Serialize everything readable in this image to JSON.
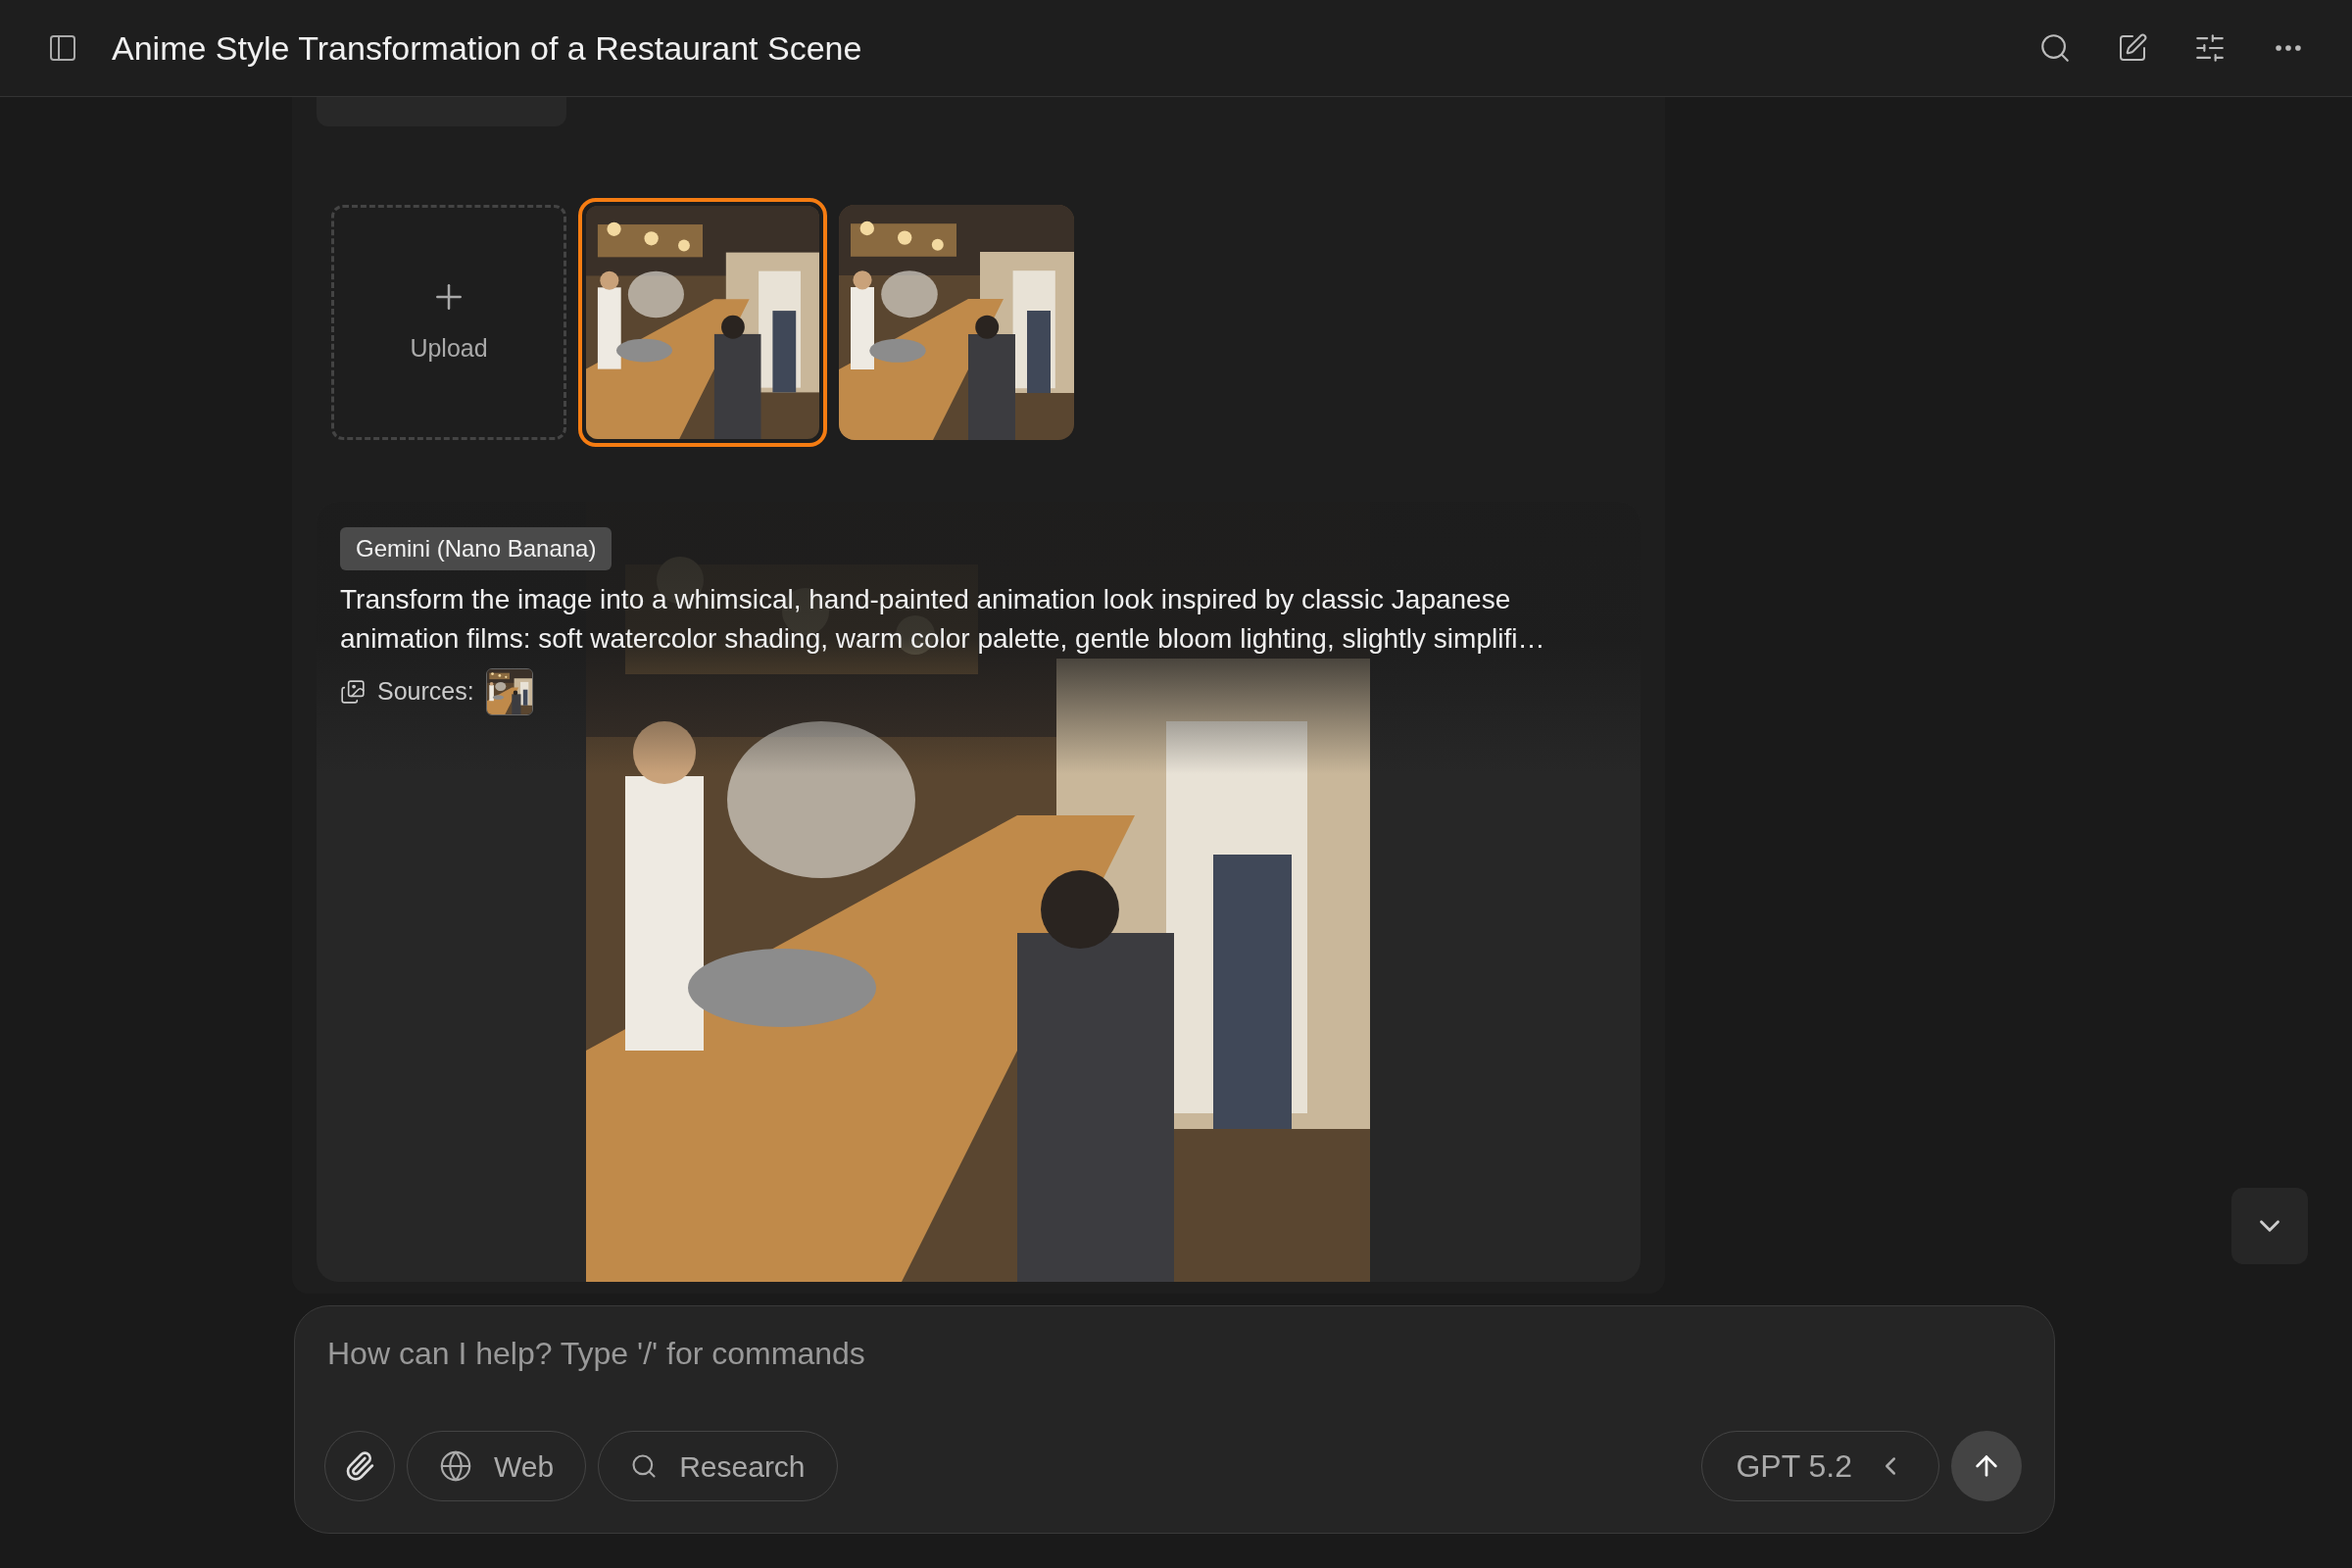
{
  "header": {
    "title": "Anime Style Transformation of a Restaurant Scene"
  },
  "upload": {
    "label": "Upload"
  },
  "thumbnails": [
    {
      "selected": true
    },
    {
      "selected": false
    }
  ],
  "result": {
    "model": "Gemini (Nano Banana)",
    "prompt": "Transform the image into a whimsical, hand-painted animation look inspired by classic Japanese animation films: soft watercolor shading, warm color palette, gentle bloom lighting, slightly simplifi…",
    "sources_label": "Sources:"
  },
  "composer": {
    "placeholder": "How can I help? Type '/' for commands",
    "buttons": [
      {
        "kind": "web",
        "label": "Web"
      },
      {
        "kind": "research",
        "label": "Research"
      }
    ],
    "model": "GPT 5.2"
  }
}
